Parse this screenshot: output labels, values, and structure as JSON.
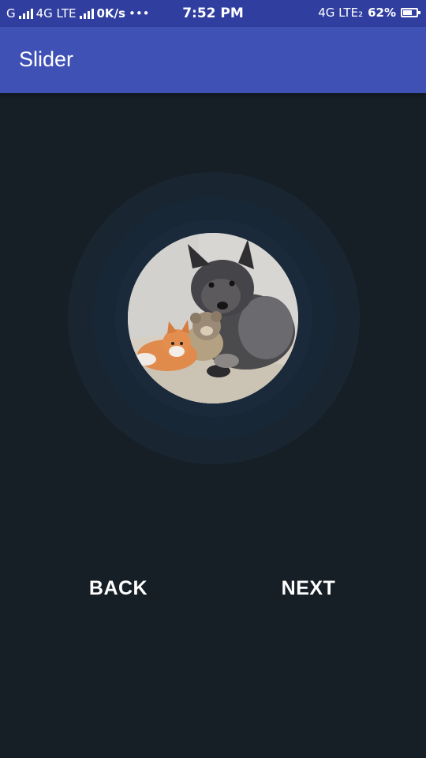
{
  "status_bar": {
    "carrier_1": "G",
    "carrier_2": "4G LTE",
    "speed": "0K/s",
    "dots": "•••",
    "time": "7:52 PM",
    "network_right": "4G LTE₂",
    "battery": "62%",
    "icons": [
      "signal-icon",
      "signal-icon",
      "battery-icon"
    ]
  },
  "toolbar": {
    "title": "Slider"
  },
  "content": {
    "image_subject": "dog-with-plush-toys-photo"
  },
  "buttons": {
    "back_label": "BACK",
    "next_label": "NEXT"
  },
  "colors": {
    "status_bar": "#303f9f",
    "toolbar": "#3f51b5",
    "background": "#161e26"
  }
}
